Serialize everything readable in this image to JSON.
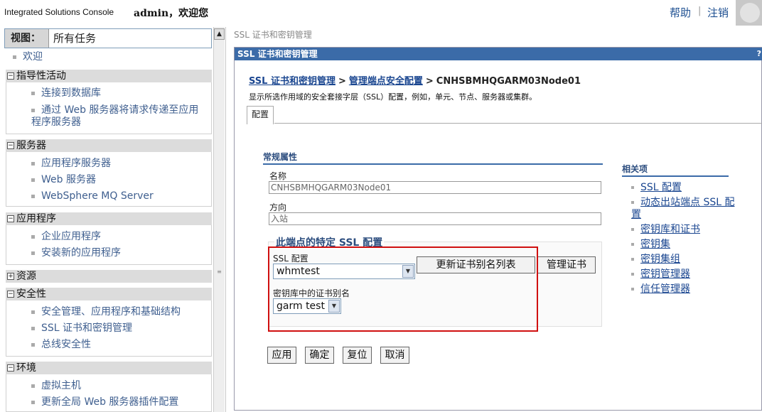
{
  "banner": {
    "product_name": "Integrated Solutions Console",
    "welcome_text": "admin，欢迎您",
    "help_link": "帮助",
    "separator": "|",
    "logout_link": "注销"
  },
  "nav": {
    "view_label": "视图：",
    "view_value": "所有任务",
    "welcome_item": "欢迎",
    "categories": [
      {
        "label": "指导性活动",
        "toggle": "−",
        "items": [
          "连接到数据库",
          "通过 Web 服务器将请求传递至应用程序服务器"
        ]
      },
      {
        "label": "服务器",
        "toggle": "−",
        "items": [
          "应用程序服务器",
          "Web 服务器",
          "WebSphere MQ Server"
        ]
      },
      {
        "label": "应用程序",
        "toggle": "−",
        "items": [
          "企业应用程序",
          "安装新的应用程序"
        ]
      },
      {
        "label": "资源",
        "toggle": "+",
        "items": []
      },
      {
        "label": "安全性",
        "toggle": "−",
        "items": [
          "安全管理、应用程序和基础结构",
          "SSL 证书和密钥管理",
          "总线安全性"
        ]
      },
      {
        "label": "环境",
        "toggle": "−",
        "items": [
          "虚拟主机",
          "更新全局 Web 服务器插件配置"
        ]
      }
    ]
  },
  "content": {
    "top_crumb": "SSL 证书和密钥管理",
    "panel_title": "SSL 证书和密钥管理",
    "panel_help": "?",
    "breadcrumb": {
      "link1": "SSL 证书和密钥管理",
      "sep": ">",
      "link2": "管理端点安全配置",
      "current": "CNHSBMHQGARM03Node01"
    },
    "description": "显示所选作用域的安全套接字层（SSL）配置，例如，单元、节点、服务器或集群。",
    "tab_label": "配置",
    "general_properties": "常规属性",
    "name_label": "名称",
    "name_value": "CNHSBMHQGARM03Node01",
    "direction_label": "方向",
    "direction_value": "入站",
    "ssl_section_title": "此端点的特定 SSL 配置",
    "ssl_config_label": "SSL 配置",
    "ssl_config_value": "whmtest",
    "refresh_alias_button": "更新证书别名列表",
    "manage_certs_button": "管理证书",
    "cert_alias_label": "密钥库中的证书别名",
    "cert_alias_value": "garm test",
    "buttons": {
      "apply": "应用",
      "ok": "确定",
      "reset": "复位",
      "cancel": "取消"
    },
    "related": {
      "title": "相关项",
      "items": [
        "SSL 配置",
        "动态出站端点 SSL 配置",
        "密钥库和证书",
        "密钥集",
        "密钥集组",
        "密钥管理器",
        "信任管理器"
      ]
    }
  }
}
